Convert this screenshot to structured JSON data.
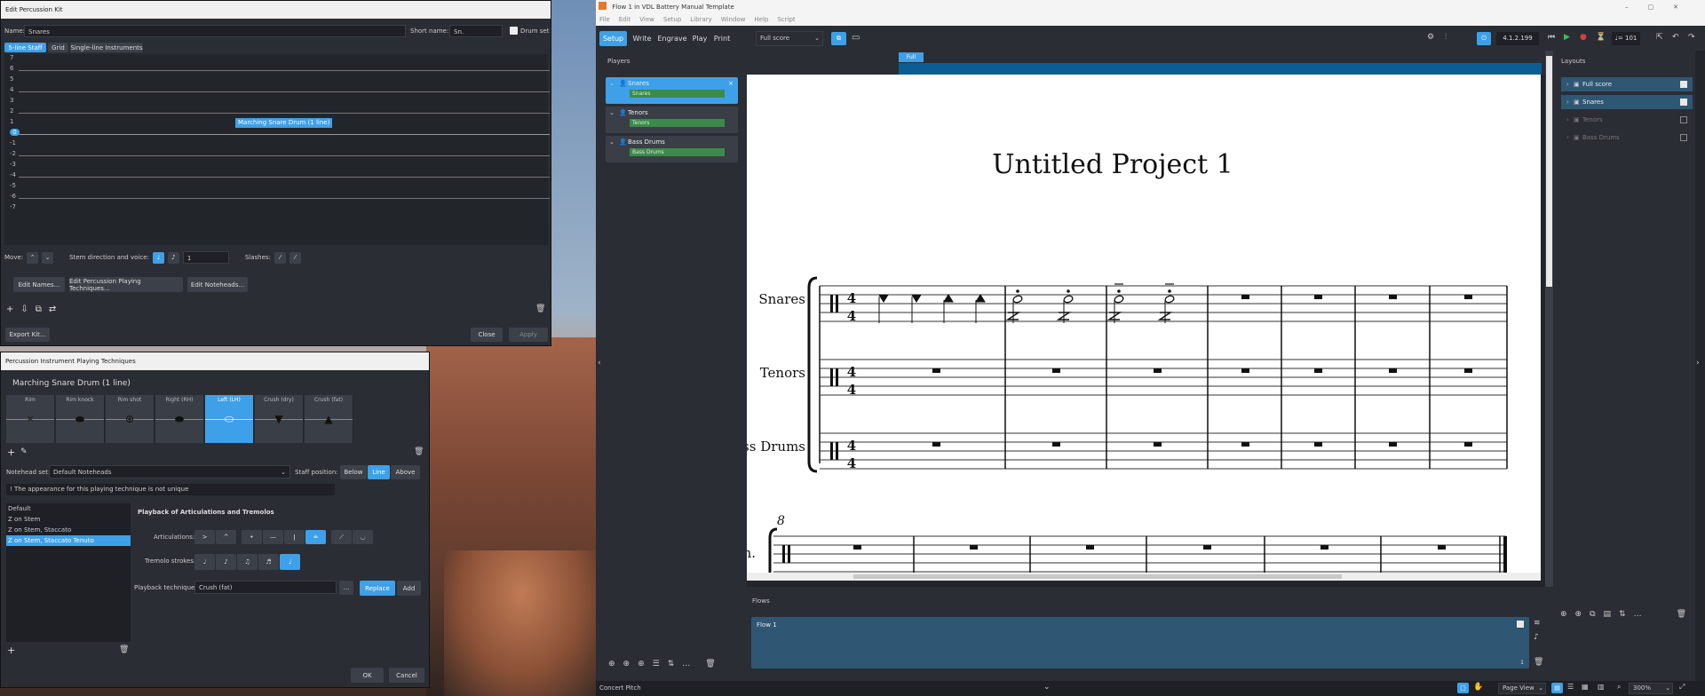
{
  "kit": {
    "title": "Edit Percussion Kit",
    "name_label": "Name:",
    "name_value": "Snares",
    "short_name_label": "Short name:",
    "short_name_value": "Sn.",
    "drum_set_label": "Drum set",
    "tabs": [
      "5-line Staff",
      "Grid",
      "Single-line Instruments"
    ],
    "staff_positions": [
      "7",
      "6",
      "5",
      "4",
      "3",
      "2",
      "1",
      "0",
      "-1",
      "-2",
      "-3",
      "-4",
      "-5",
      "-6",
      "-7"
    ],
    "instrument_tag": "Marching Snare Drum (1 line)",
    "move_label": "Move:",
    "stem_label": "Stem direction and voice:",
    "voice_value": "1",
    "slashes_label": "Slashes:",
    "edit_names": "Edit Names...",
    "edit_techniques": "Edit Percussion Playing Techniques...",
    "edit_noteheads": "Edit Noteheads...",
    "export_kit": "Export Kit...",
    "close": "Close",
    "apply": "Apply"
  },
  "pt": {
    "title": "Percussion Instrument Playing Techniques",
    "instrument": "Marching Snare Drum (1 line)",
    "techniques": [
      {
        "name": "Rim",
        "glyph": "✕"
      },
      {
        "name": "Rim knock",
        "glyph": "⬬"
      },
      {
        "name": "Rim shot",
        "glyph": "⊕"
      },
      {
        "name": "Right (RH)",
        "glyph": "⬬"
      },
      {
        "name": "Left (LH)",
        "glyph": "⬭"
      },
      {
        "name": "Crush (dry)",
        "glyph": "▼"
      },
      {
        "name": "Crush (fat)",
        "glyph": "▲"
      }
    ],
    "notehead_set_label": "Notehead set:",
    "notehead_set_value": "Default Noteheads",
    "staff_position_label": "Staff position:",
    "staff_positions": [
      "Below",
      "Line",
      "Above"
    ],
    "warning": "! The appearance for this playing technique is not unique",
    "list": [
      "Default",
      "Z on Stem",
      "Z on Stem, Staccato",
      "Z on Stem, Staccato Tenuto"
    ],
    "playback_heading": "Playback of Articulations and Tremolos",
    "articulations_label": "Articulations:",
    "tremolo_label": "Tremolo strokes:",
    "playback_technique_label": "Playback technique:",
    "playback_technique_value": "Crush (fat)",
    "ellipsis": "...",
    "replace": "Replace",
    "add": "Add",
    "ok": "OK",
    "cancel": "Cancel"
  },
  "dorico": {
    "window_title": "Flow 1 in VDL Battery Manual Template",
    "menu": [
      "File",
      "Edit",
      "View",
      "Setup",
      "Library",
      "Window",
      "Help",
      "Script"
    ],
    "modes": [
      "Setup",
      "Write",
      "Engrave",
      "Play",
      "Print"
    ],
    "layout_select": "Full score",
    "time": "4.1.2.199",
    "tempo": "= 101",
    "players_heading": "Players",
    "players": [
      {
        "name": "Snares",
        "instrument": "Snares"
      },
      {
        "name": "Tenors",
        "instrument": "Tenors"
      },
      {
        "name": "Bass Drums",
        "instrument": "Bass Drums"
      }
    ],
    "tab": "Full score",
    "score_title": "Untitled Project 1",
    "staff_labels": [
      "Snares",
      "Tenors",
      "ss Drums"
    ],
    "system2_number": "8",
    "system2_label": "n.",
    "layouts_heading": "Layouts",
    "layouts": [
      {
        "name": "Full score",
        "checked": true
      },
      {
        "name": "Snares",
        "checked": true
      },
      {
        "name": "Tenors",
        "checked": false
      },
      {
        "name": "Bass Drums",
        "checked": false
      }
    ],
    "flows_heading": "Flows",
    "flow_name": "Flow 1",
    "flow_number": "1",
    "concert_pitch": "Concert Pitch",
    "view_mode": "Page View",
    "zoom": "300%",
    "accent": "#3ea0e8"
  }
}
